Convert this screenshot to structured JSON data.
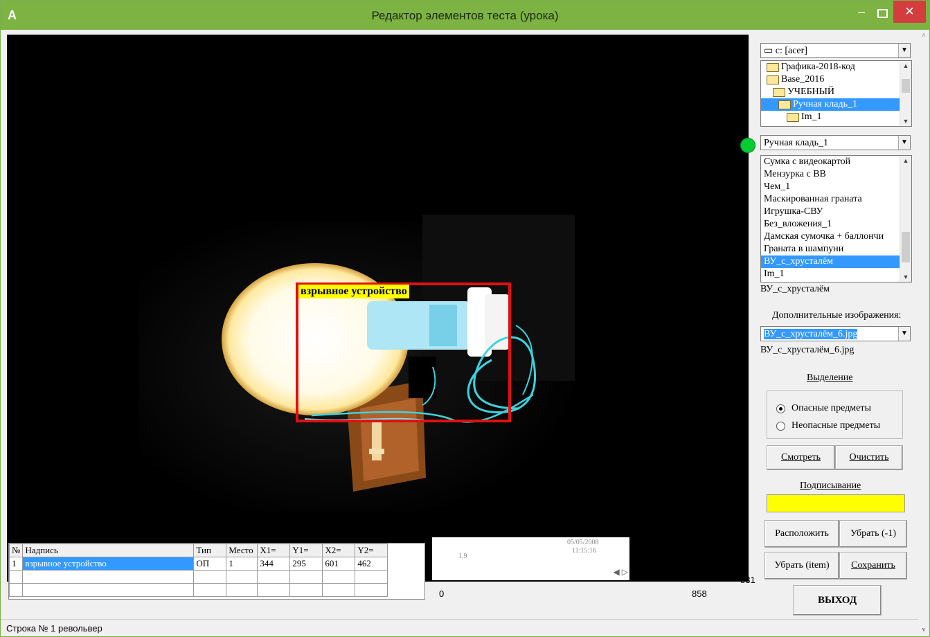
{
  "window": {
    "title": "Редактор элементов теста (урока)",
    "icon": "app-icon",
    "controls": {
      "minimize": "–",
      "close": "✕"
    }
  },
  "canvas": {
    "annotation_label": "взрывное устройство",
    "annotation_color": "#e01010",
    "label_bg": "#ffff00"
  },
  "grid": {
    "columns": [
      "№",
      "Надпись",
      "Тип",
      "Место",
      "X1=",
      "Y1=",
      "X2=",
      "Y2="
    ],
    "rows": [
      [
        "1",
        "взрывное устройство",
        "ОП",
        "1",
        "344",
        "295",
        "601",
        "462"
      ],
      [
        "",
        "",
        "",
        "",
        "",
        "",
        "",
        ""
      ],
      [
        "",
        "",
        "",
        "",
        "",
        "",
        "",
        ""
      ]
    ]
  },
  "thumb": {
    "text_a": "1,9",
    "date": "05/05/2008",
    "time": "11:15:16"
  },
  "readouts": {
    "min": "0",
    "max": "858",
    "y_value": "531"
  },
  "status": {
    "text": "Строка № 1  револьвер"
  },
  "right": {
    "drive_combo": "c: [acer]",
    "folders": [
      "Графика-2018-код",
      "Base_2016",
      "УЧЕБНЫЙ",
      "Ручная кладь_1",
      "Im_1"
    ],
    "folder_selected_index": 3,
    "folder_combo": "Ручная кладь_1",
    "status_color": "#00cc33",
    "files": [
      "Сумка с видеокартой",
      "Мензурка с ВВ",
      "Чем_1",
      "Маскированная граната",
      "Игрушка-СВУ",
      "Без_вложения_1",
      "Дамская сумочка + баллончи",
      "Граната в шампуни",
      "ВУ_с_хрусталём",
      "Im_1"
    ],
    "file_selected_index": 8,
    "file_current": "ВУ_с_хрусталём",
    "extra_label": "Дополнительные изображения:",
    "extra_combo": "ВУ_с_хрусталём_6.jpg",
    "extra_current": "ВУ_с_хрусталём_6.jpg",
    "selection_title": "Выделение",
    "radio_dangerous": "Опасные предметы",
    "radio_safe": "Неопасные предметы",
    "radio_selected": "dangerous",
    "btn_view": "Смотреть",
    "btn_clear": "Очистить",
    "caption_title": "Подписывание",
    "caption_value": "",
    "btn_place": "Расположить",
    "btn_remove_one": "Убрать (-1)",
    "btn_remove_item": "Убрать (item)",
    "btn_save": "Сохранить",
    "btn_exit": "ВЫХОД"
  }
}
